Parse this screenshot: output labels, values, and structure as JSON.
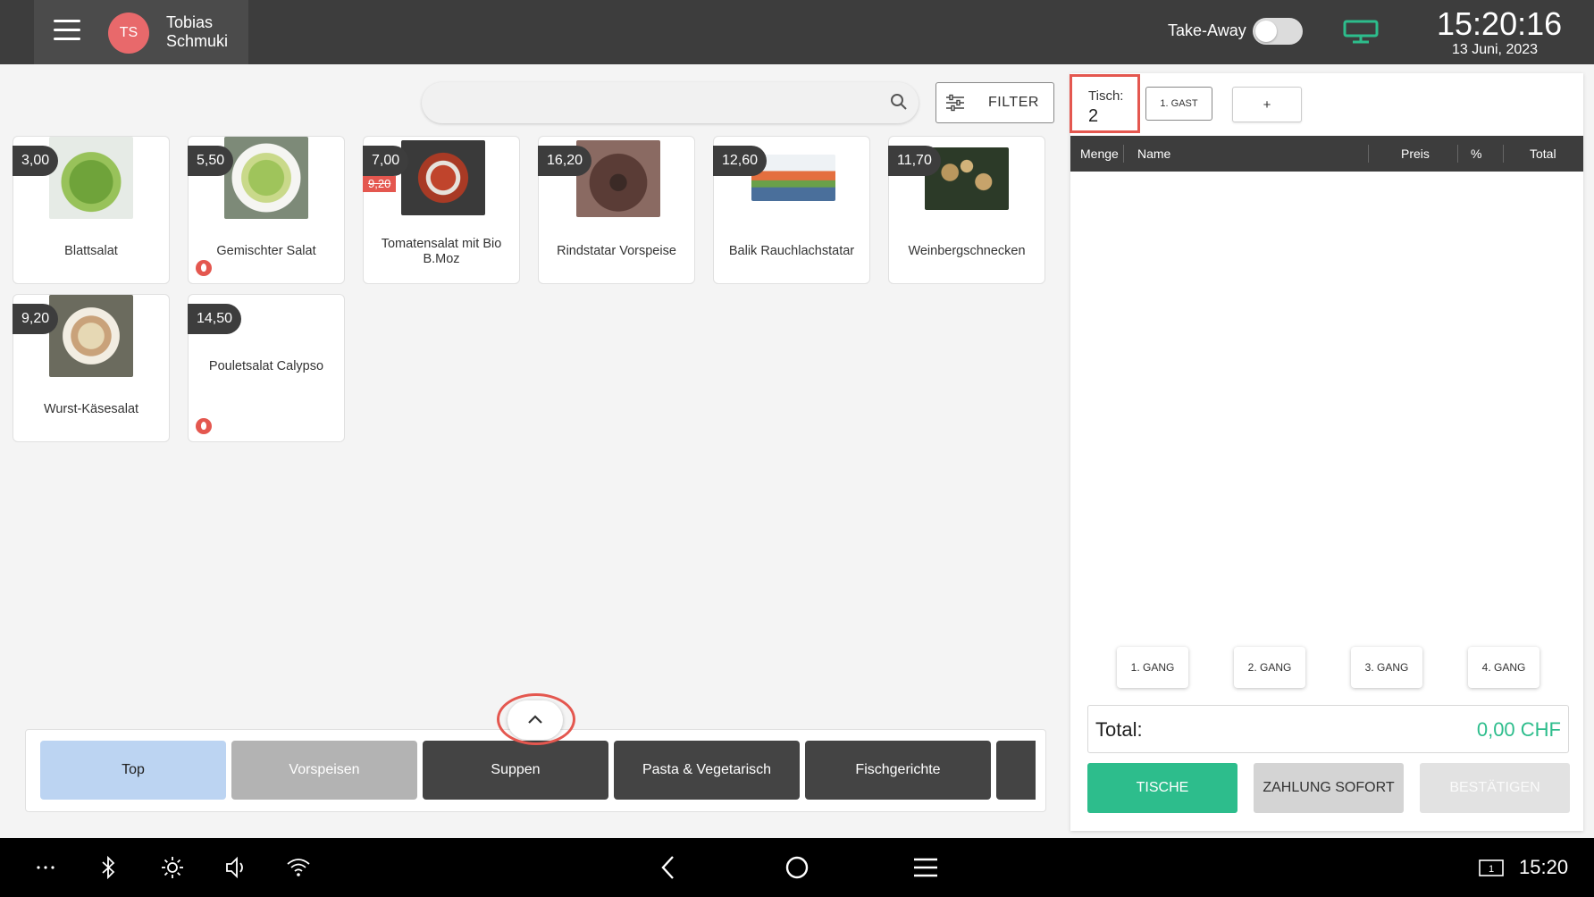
{
  "header": {
    "user_initials": "TS",
    "user_name_line1": "Tobias",
    "user_name_line2": "Schmuki",
    "takeaway_label": "Take-Away",
    "takeaway_enabled": false,
    "time": "15:20:16",
    "date": "13 Juni, 2023"
  },
  "search": {
    "placeholder": "",
    "filter_label": "FILTER"
  },
  "products": [
    {
      "name": "Blattsalat",
      "price": "3,00"
    },
    {
      "name": "Gemischter Salat",
      "price": "5,50",
      "badge": "flame"
    },
    {
      "name": "Tomatensalat mit Bio B.Moz",
      "price": "7,00",
      "old_price": "9,20"
    },
    {
      "name": "Rindstatar Vorspeise",
      "price": "16,20"
    },
    {
      "name": "Balik Rauchlachstatar",
      "price": "12,60"
    },
    {
      "name": "Weinbergschnecken",
      "price": "11,70"
    },
    {
      "name": "Wurst-Käsesalat",
      "price": "9,20"
    },
    {
      "name": "Pouletsalat Calypso",
      "price": "14,50",
      "badge": "flame"
    }
  ],
  "categories": [
    {
      "label": "Top",
      "color": "#bcd4f2",
      "text_color": "#222"
    },
    {
      "label": "Vorspeisen",
      "color": "#b3b3b3",
      "text_color": "#fff"
    },
    {
      "label": "Suppen",
      "color": "#444444",
      "text_color": "#fff"
    },
    {
      "label": "Pasta & Vegetarisch",
      "color": "#444444",
      "text_color": "#fff"
    },
    {
      "label": "Fischgerichte",
      "color": "#444444",
      "text_color": "#fff"
    }
  ],
  "order": {
    "table_label": "Tisch:",
    "table_number": "2",
    "guest_label": "1. GAST",
    "add_label": "+",
    "columns": {
      "menge": "Menge",
      "name": "Name",
      "preis": "Preis",
      "percent": "%",
      "total": "Total"
    },
    "courses": [
      "1. GANG",
      "2. GANG",
      "3. GANG",
      "4. GANG"
    ],
    "total_label": "Total:",
    "total_value": "0,00 CHF",
    "buttons": {
      "tische": "TISCHE",
      "zahlung": "ZAHLUNG SOFORT",
      "bestaetigen": "BESTÄTIGEN"
    }
  },
  "system_bar": {
    "time": "15:20",
    "screen_number": "1"
  },
  "colors": {
    "accent_green": "#2dbd8c",
    "highlight_red": "#e4574f",
    "dark": "#3d3d3d"
  }
}
